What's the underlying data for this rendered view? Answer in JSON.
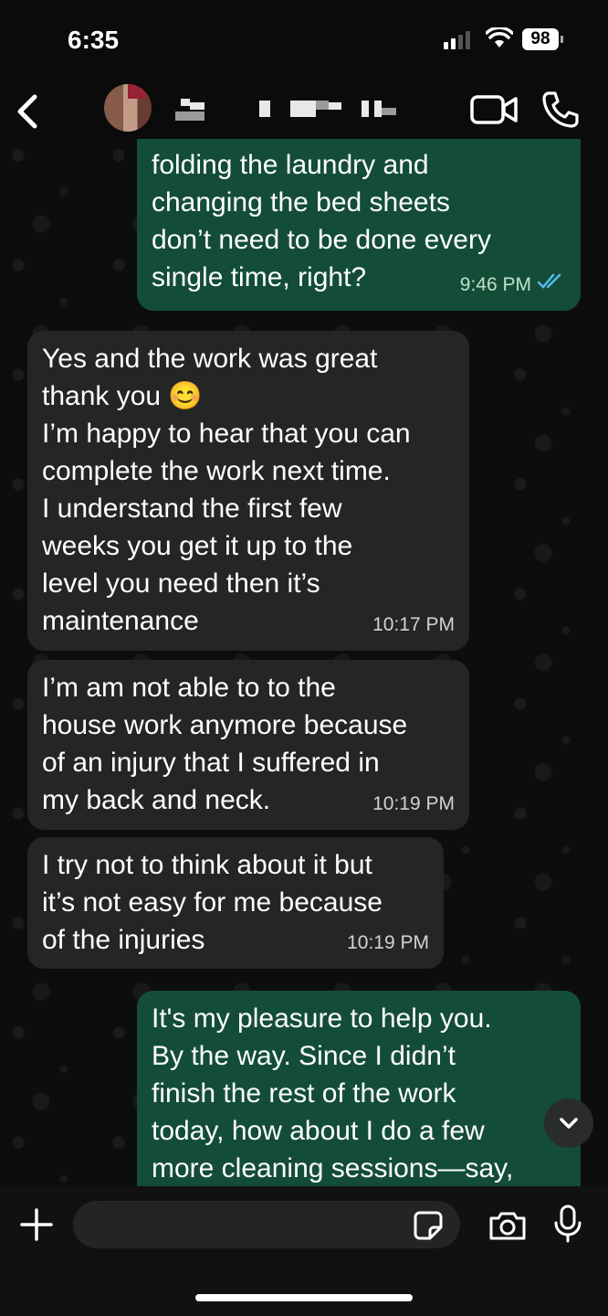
{
  "status_bar": {
    "time": "6:35",
    "battery": "98"
  },
  "header": {
    "back_icon": "chevron-left-icon",
    "video_icon": "video-camera-icon",
    "call_icon": "phone-icon"
  },
  "messages": [
    {
      "direction": "outgoing",
      "text": "folding the laundry and\nchanging the bed sheets\ndon’t need to be done every\nsingle time, right?",
      "time": "9:46 PM",
      "status": "read"
    },
    {
      "direction": "incoming",
      "text": "Yes and the work was great\nthank you 😊\nI’m happy to hear that you can\ncomplete the work next time.\nI understand the first few\nweeks you get it up to the\nlevel you need then it’s\nmaintenance",
      "time": "10:17 PM"
    },
    {
      "direction": "incoming",
      "text": "I’m am not able to to the\nhouse work anymore because\nof an injury that I suffered in\nmy back and neck.",
      "time": "10:19 PM"
    },
    {
      "direction": "incoming",
      "text": "I try not to think about it but\nit’s not easy for me because\nof the injuries",
      "time": "10:19 PM"
    },
    {
      "direction": "outgoing",
      "text": "It's my pleasure to help you.\nBy the way. Since I didn’t\nfinish the rest of the work\ntoday, how about I do a few\nmore cleaning sessions—say,",
      "time": ""
    }
  ],
  "composer": {
    "plus_icon": "plus-icon",
    "sticker_icon": "sticker-icon",
    "camera_icon": "camera-icon",
    "mic_icon": "microphone-icon",
    "input_value": ""
  },
  "colors": {
    "outgoing_bubble": "#144d37",
    "incoming_bubble": "#242626",
    "read_receipt": "#53bdeb"
  }
}
